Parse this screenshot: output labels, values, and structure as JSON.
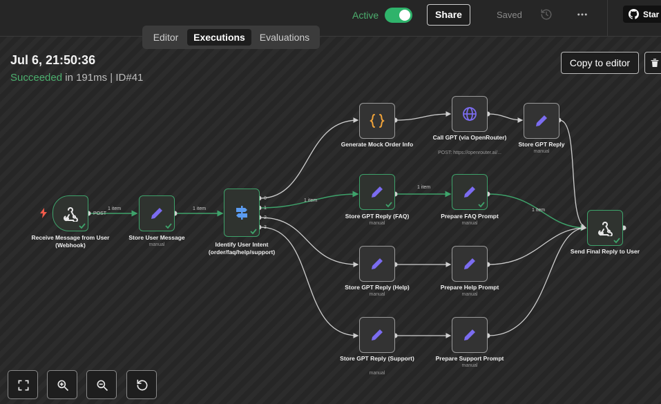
{
  "header": {
    "active_label": "Active",
    "active_on": true,
    "share_label": "Share",
    "saved_label": "Saved",
    "history_icon": "history-icon",
    "more_icon": "more-icon",
    "github_label": "Star"
  },
  "tabs": [
    {
      "label": "Editor",
      "active": false
    },
    {
      "label": "Executions",
      "active": true
    },
    {
      "label": "Evaluations",
      "active": false
    }
  ],
  "execution": {
    "date": "Jul 6, 21:50:36",
    "status": "Succeeded",
    "duration": "in 191ms",
    "separator": "|",
    "id": "ID#41"
  },
  "actions": {
    "copy_label": "Copy to editor",
    "delete_icon": "trash-icon"
  },
  "colors": {
    "success": "#3ea36b",
    "accent_purple": "#7b6cf0",
    "accent_orange": "#f0a33a",
    "node_border": "#9a9a9a"
  },
  "nodes": {
    "webhook": {
      "label": "Receive Message from User (Webhook)",
      "icon": "webhook-icon",
      "port_label": "POST"
    },
    "store_user": {
      "label": "Store User Message",
      "sub": "manual",
      "icon": "pencil-icon"
    },
    "switch": {
      "label": "Identify User Intent (order/faq/help/support)",
      "icon": "signpost-icon",
      "outputs": [
        "0",
        "1",
        "2",
        "3"
      ]
    },
    "mock": {
      "label": "Generate Mock Order Info",
      "icon": "code-braces-icon"
    },
    "call_gpt": {
      "label": "Call GPT (via OpenRouter)",
      "sub": "POST: https://openrouter.ai/...",
      "icon": "globe-icon"
    },
    "store_gpt": {
      "label": "Store GPT Reply",
      "sub": "manual",
      "icon": "pencil-icon"
    },
    "store_faq": {
      "label": "Store GPT Reply (FAQ)",
      "sub": "manual",
      "icon": "pencil-icon"
    },
    "prep_faq": {
      "label": "Prepare FAQ Prompt",
      "sub": "manual",
      "icon": "pencil-icon"
    },
    "store_help": {
      "label": "Store GPT Reply (Help)",
      "sub": "manual",
      "icon": "pencil-icon"
    },
    "prep_help": {
      "label": "Prepare Help Prompt",
      "sub": "manual",
      "icon": "pencil-icon"
    },
    "store_support": {
      "label": "Store GPT Reply (Support)",
      "sub": "manual",
      "icon": "pencil-icon"
    },
    "prep_support": {
      "label": "Prepare Support Prompt",
      "sub": "manual",
      "icon": "pencil-icon"
    },
    "send_final": {
      "label": "Send Final Reply to User",
      "icon": "webhook-icon"
    }
  },
  "edge_labels": {
    "webhook_to_store": "1 item",
    "store_to_switch": "1 item",
    "switch_to_faq": "1 item",
    "faq_to_prep": "1 item",
    "prep_to_final": "1 item"
  },
  "controls": [
    {
      "name": "fit-view-button",
      "icon": "expand-icon"
    },
    {
      "name": "zoom-in-button",
      "icon": "zoom-in-icon"
    },
    {
      "name": "zoom-out-button",
      "icon": "zoom-out-icon"
    },
    {
      "name": "reset-zoom-button",
      "icon": "undo-icon"
    }
  ]
}
